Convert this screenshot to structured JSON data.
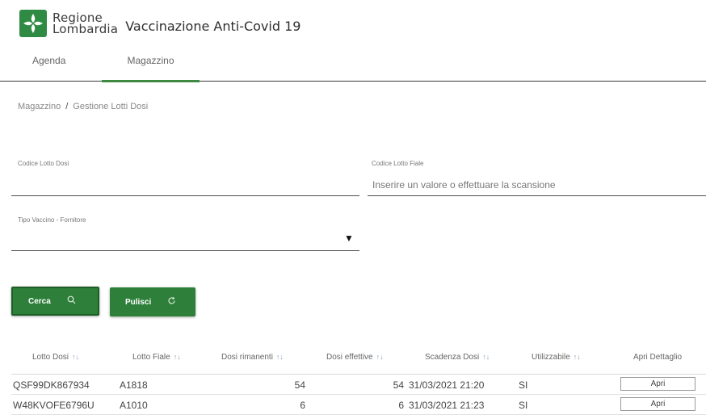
{
  "header": {
    "logo_line1": "Regione",
    "logo_line2": "Lombardia",
    "app_title": "Vaccinazione Anti-Covid 19"
  },
  "tabs": [
    {
      "label": "Agenda",
      "active": false
    },
    {
      "label": "Magazzino",
      "active": true
    }
  ],
  "breadcrumb": {
    "root": "Magazzino",
    "separator": "/",
    "current": "Gestione Lotti Dosi"
  },
  "form": {
    "codice_lotto_dosi": {
      "label": "Codice Lotto Dosi",
      "value": ""
    },
    "codice_lotto_fiale": {
      "label": "Codice Lotto Fiale",
      "placeholder": "Inserire un valore o effettuare la scansione"
    },
    "tipo_vaccino": {
      "label": "Tipo Vaccino - Fornitore",
      "value": ""
    }
  },
  "buttons": {
    "cerca": "Cerca",
    "pulisci": "Pulisci"
  },
  "table": {
    "headers": [
      "Lotto Dosi",
      "Lotto Fiale",
      "Dosi rimanenti",
      "Dosi effettive",
      "Scadenza Dosi",
      "Utilizzabile",
      "Apri Dettaglio"
    ],
    "sort_glyph": "↑↓",
    "rows": [
      {
        "lotto_dosi": "QSF99DK867934",
        "lotto_fiale": "A1818",
        "dosi_rimanenti": "54",
        "dosi_effettive": "54",
        "scadenza": "31/03/2021 21:20",
        "utilizzabile": "SI",
        "action": "Apri"
      },
      {
        "lotto_dosi": "W48KVOFE6796U",
        "lotto_fiale": "A1010",
        "dosi_rimanenti": "6",
        "dosi_effettive": "6",
        "scadenza": "31/03/2021 21:23",
        "utilizzabile": "SI",
        "action": "Apri"
      }
    ]
  },
  "colors": {
    "brand_green": "#2d7f3a",
    "tab_underline": "#3f8a42"
  }
}
